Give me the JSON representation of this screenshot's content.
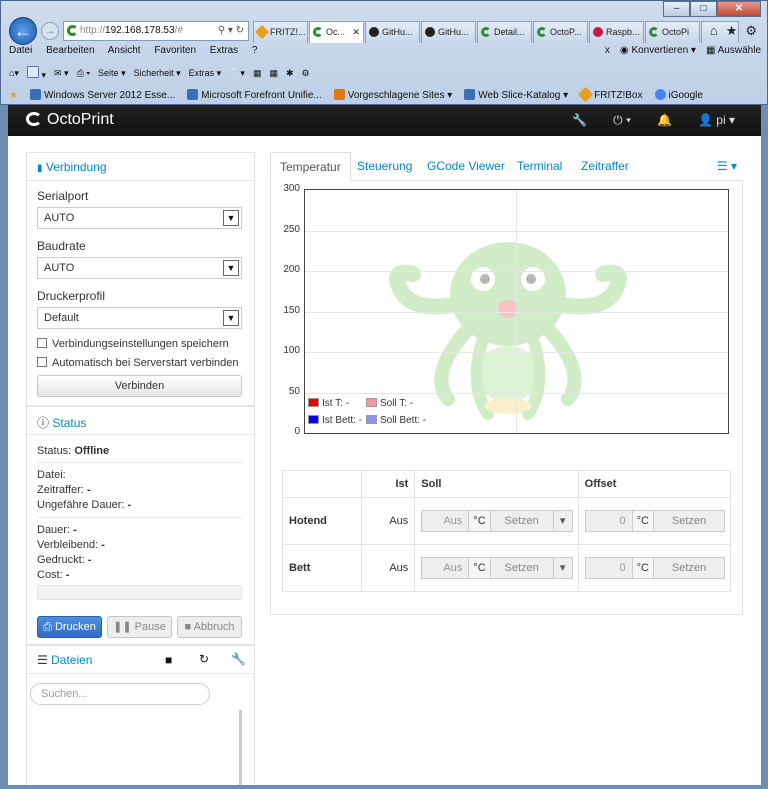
{
  "browser": {
    "address": {
      "prefix": "http://",
      "host": "192.168.178.53",
      "suffix": "/#"
    },
    "tabs": [
      {
        "label": "FRITZ!...",
        "icon": "fritz-icon"
      },
      {
        "label": "Oc...",
        "icon": "octoprint-icon",
        "active": true,
        "close": "✕"
      },
      {
        "label": "GitHu...",
        "icon": "github-icon"
      },
      {
        "label": "GitHu...",
        "icon": "github-icon"
      },
      {
        "label": "Detail...",
        "icon": "octoprint-icon"
      },
      {
        "label": "OctoP...",
        "icon": "octoprint-icon"
      },
      {
        "label": "Raspb...",
        "icon": "raspberry-icon"
      },
      {
        "label": "OctoPi",
        "icon": "octoprint-icon"
      }
    ],
    "window_controls": {
      "minimize": "–",
      "maximize": "□",
      "close": "✕"
    },
    "menu": [
      "Datei",
      "Bearbeiten",
      "Ansicht",
      "Favoriten",
      "Extras",
      "?"
    ],
    "menu_right": {
      "close": "x",
      "convert": "Konvertieren",
      "select": "Auswähle"
    },
    "commands": [
      "Seite",
      "Sicherheit",
      "Extras"
    ],
    "favorites": [
      {
        "label": "Windows Server 2012 Esse...",
        "color": "#3a6fb5"
      },
      {
        "label": "Microsoft Forefront Unifie...",
        "color": "#3a6fb5"
      },
      {
        "label": "Vorgeschlagene Sites ▾",
        "color": "#e07a10"
      },
      {
        "label": "Web Slice-Katalog ▾",
        "color": "#3a6fb5"
      },
      {
        "label": "FRITZ!Box",
        "color": "#e8a021"
      },
      {
        "label": "iGoogle",
        "color": "#4285f4"
      }
    ]
  },
  "app": {
    "brand": "OctoPrint",
    "user": "pi"
  },
  "connection": {
    "title": "Verbindung",
    "serialport_label": "Serialport",
    "serialport_value": "AUTO",
    "baudrate_label": "Baudrate",
    "baudrate_value": "AUTO",
    "profile_label": "Druckerprofil",
    "profile_value": "Default",
    "save_settings": "Verbindungseinstellungen speichern",
    "autoconnect": "Automatisch bei Serverstart verbinden",
    "connect_button": "Verbinden"
  },
  "status": {
    "title": "Status",
    "state_label": "Status:",
    "state_value": "Offline",
    "file_label": "Datei:",
    "timelapse_label": "Zeitraffer:",
    "timelapse_value": "-",
    "approx_label": "Ungefähre Dauer:",
    "approx_value": "-",
    "duration_label": "Dauer:",
    "duration_value": "-",
    "remaining_label": "Verbleibend:",
    "remaining_value": "-",
    "printed_label": "Gedruckt:",
    "printed_value": "-",
    "cost_label": "Cost:",
    "cost_value": "-",
    "print_button": "Drucken",
    "pause_button": "Pause",
    "cancel_button": "Abbruch"
  },
  "files": {
    "title": "Dateien",
    "search_placeholder": "Suchen..."
  },
  "tabs": [
    "Temperatur",
    "Steuerung",
    "GCode Viewer",
    "Terminal",
    "Zeitraffer"
  ],
  "chart_data": {
    "type": "line",
    "title": "",
    "xlabel": "",
    "ylabel": "",
    "ylim": [
      0,
      300
    ],
    "yticks": [
      "300",
      "250",
      "200",
      "150",
      "100",
      "50",
      "0"
    ],
    "grid": true,
    "legend_position": "bottom-left",
    "series": [
      {
        "name": "Ist T: -",
        "color": "#ee0000",
        "values": []
      },
      {
        "name": "Soll T: -",
        "color": "#f59a9a",
        "values": []
      },
      {
        "name": "Ist Bett: -",
        "color": "#0000ee",
        "values": []
      },
      {
        "name": "Soll Bett: -",
        "color": "#8f8ff5",
        "values": []
      }
    ]
  },
  "temp_table": {
    "headers": [
      "",
      "Ist",
      "Soll",
      "Offset"
    ],
    "rows": [
      {
        "name": "Hotend",
        "actual": "Aus",
        "target": "Aus",
        "unit": "°C",
        "set": "Setzen",
        "offset": "0",
        "offset_unit": "°C",
        "offset_set": "Setzen"
      },
      {
        "name": "Bett",
        "actual": "Aus",
        "target": "Aus",
        "unit": "°C",
        "set": "Setzen",
        "offset": "0",
        "offset_unit": "°C",
        "offset_set": "Setzen"
      }
    ]
  }
}
